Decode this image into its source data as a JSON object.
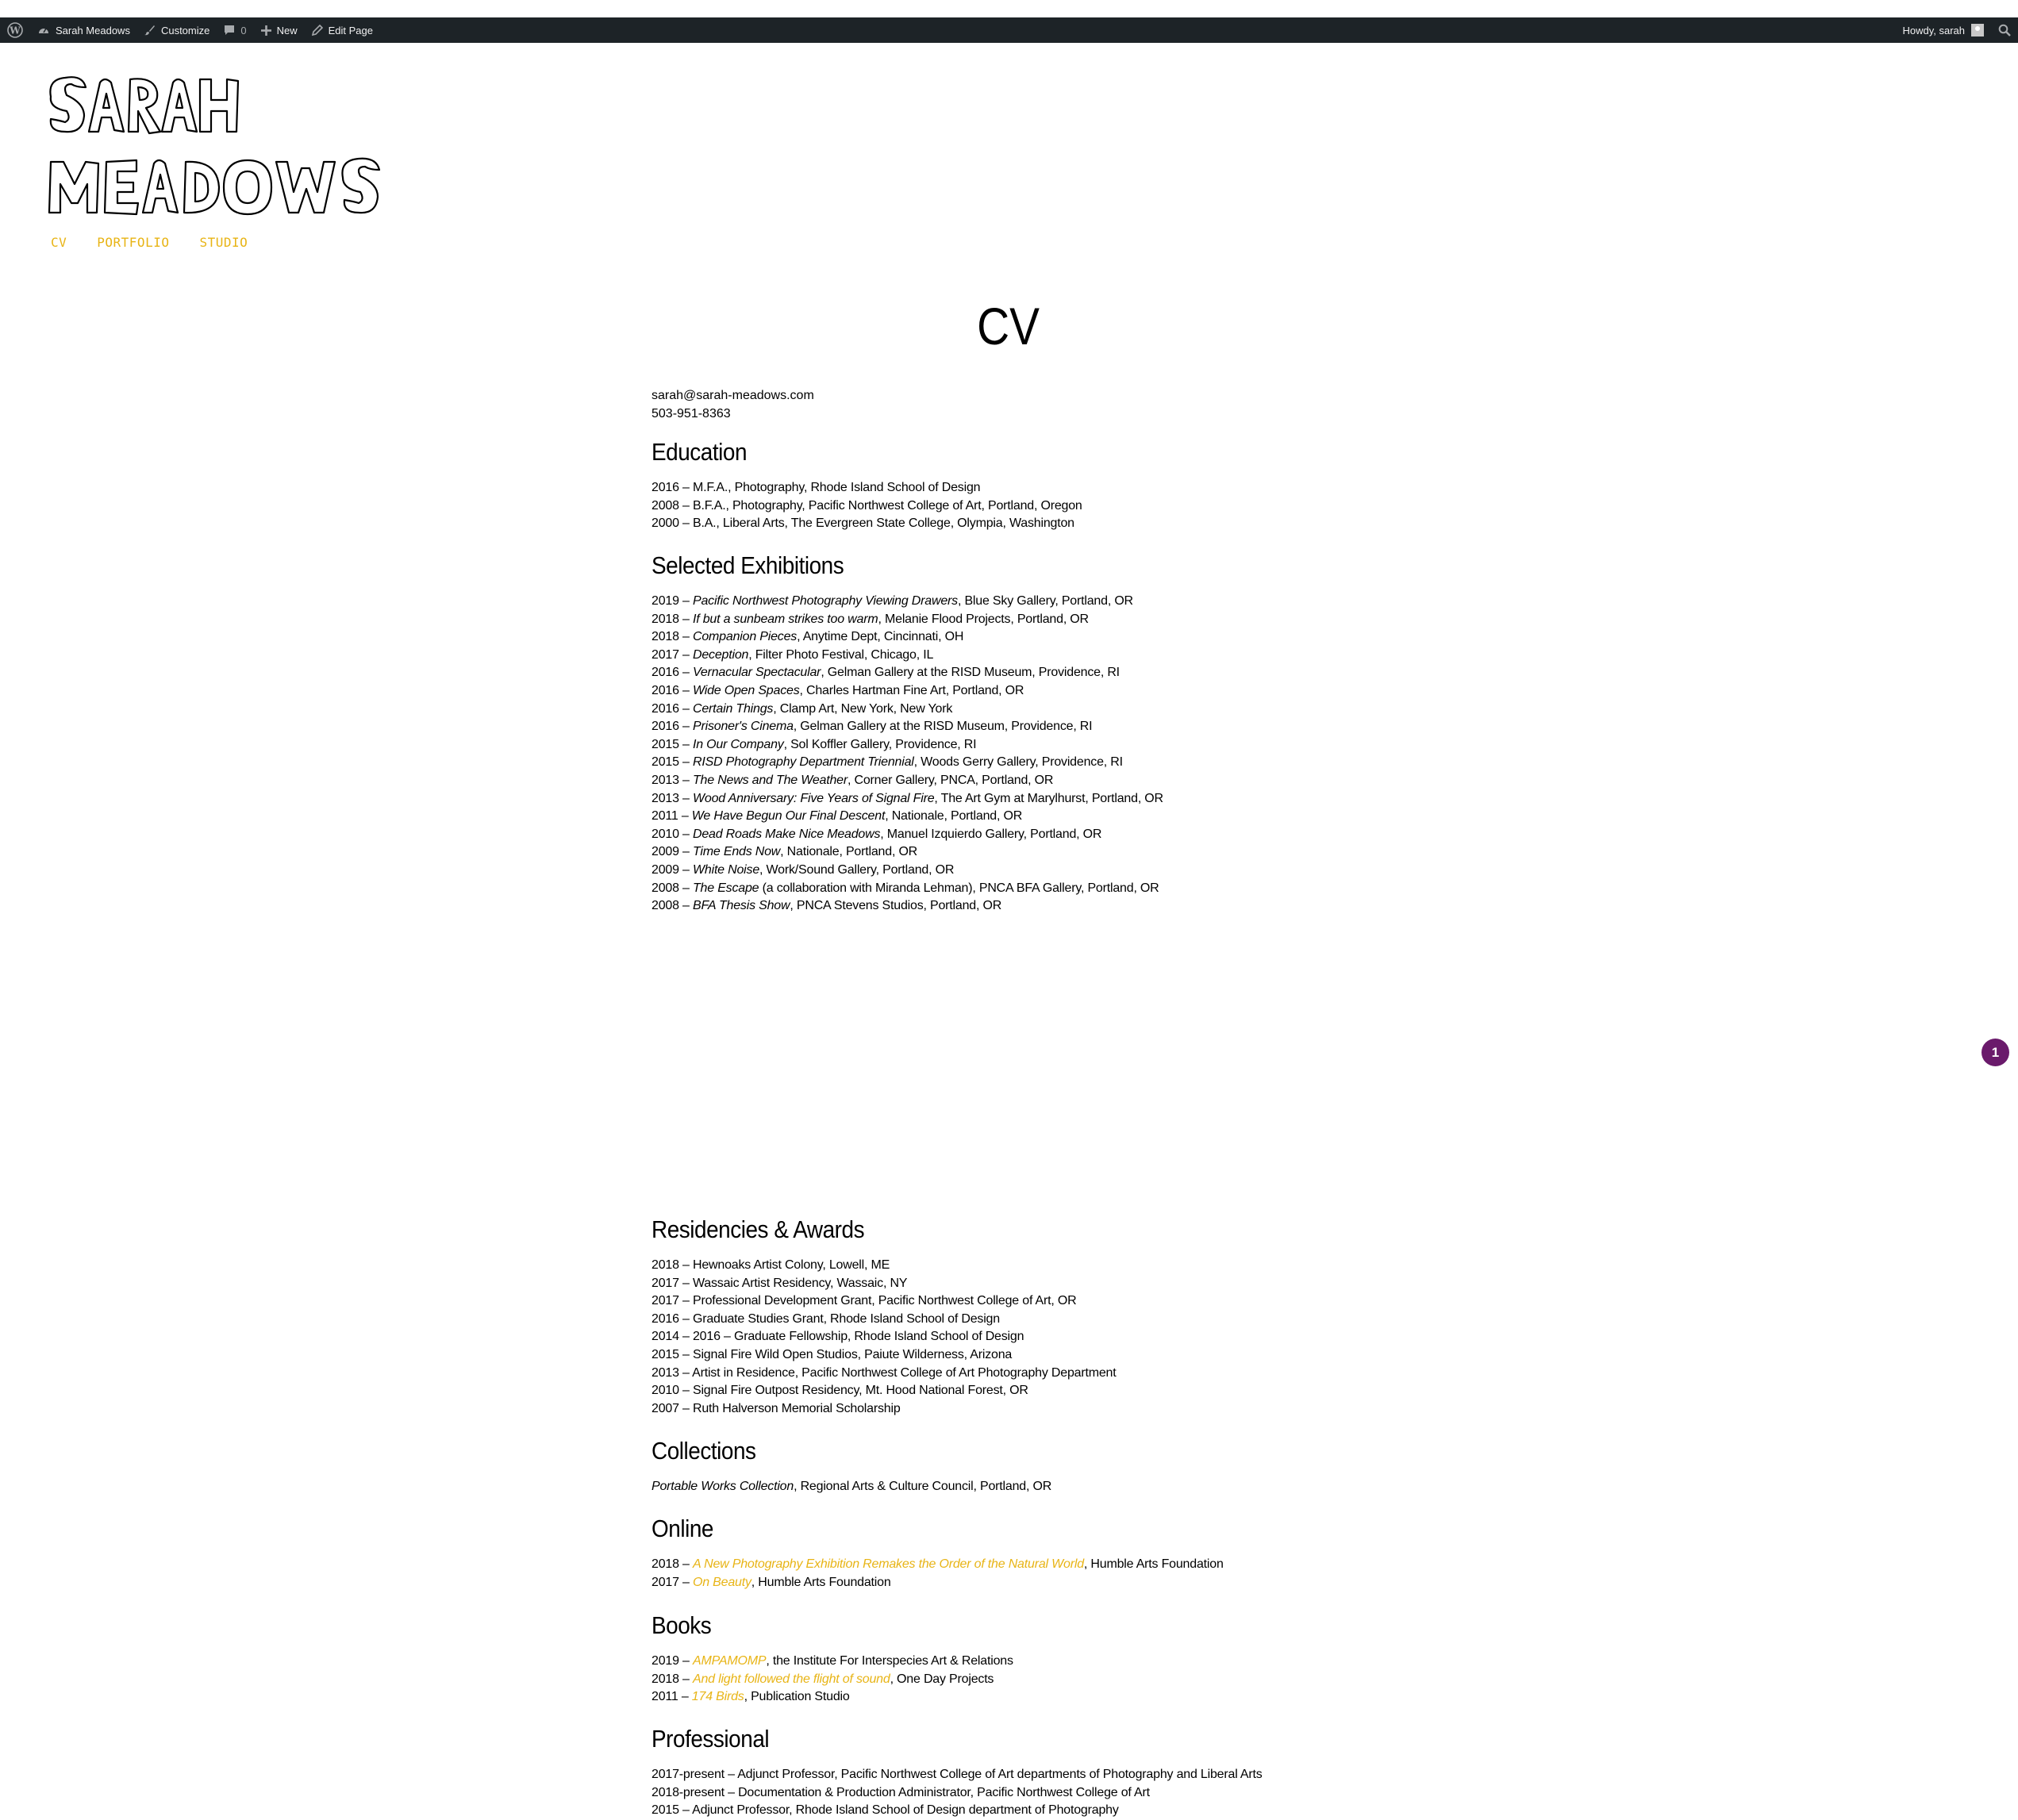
{
  "admin_bar": {
    "site_name": "Sarah Meadows",
    "customize": "Customize",
    "comments_count": "0",
    "new_label": "New",
    "edit_page": "Edit Page",
    "howdy": "Howdy, sarah"
  },
  "site": {
    "logo_text": "SARAH MEADOWS",
    "accent_color": "#e8b415"
  },
  "nav": [
    "CV",
    "PORTFOLIO",
    "STUDIO"
  ],
  "page": {
    "title": "CV",
    "email": "sarah@sarah-meadows.com",
    "phone": "503-951-8363"
  },
  "education": {
    "heading": "Education",
    "items": [
      "2016 – M.F.A., Photography, Rhode Island School of Design",
      "2008 – B.F.A., Photography, Pacific Northwest College of Art, Portland, Oregon",
      "2000 – B.A., Liberal Arts, The Evergreen State College, Olympia, Washington"
    ]
  },
  "exhibitions": {
    "heading": "Selected Exhibitions",
    "items": [
      {
        "year": "2019 – ",
        "title": "Pacific Northwest Photography Viewing Drawers",
        "rest": ", Blue Sky Gallery, Portland, OR"
      },
      {
        "year": "2018 – ",
        "title": "If but a sunbeam strikes too warm",
        "rest": ", Melanie Flood Projects, Portland, OR"
      },
      {
        "year": "2018 – ",
        "title": "Companion Pieces",
        "rest": ", Anytime Dept, Cincinnati, OH"
      },
      {
        "year": "2017 – ",
        "title": "Deception",
        "rest": ", Filter Photo Festival, Chicago, IL"
      },
      {
        "year": "2016 – ",
        "title": "Vernacular Spectacular",
        "rest": ", Gelman Gallery at the RISD Museum, Providence, RI"
      },
      {
        "year": "2016 – ",
        "title": "Wide Open Spaces",
        "rest": ", Charles Hartman Fine Art, Portland, OR"
      },
      {
        "year": "2016 – ",
        "title": "Certain Things",
        "rest": ", Clamp Art, New York, New York"
      },
      {
        "year": "2016 – ",
        "title": "Prisoner's Cinema",
        "rest": ", Gelman Gallery at the RISD Museum, Providence, RI"
      },
      {
        "year": "2015 – ",
        "title": "In Our Company",
        "rest": ", Sol Koffler Gallery, Providence, RI"
      },
      {
        "year": "2015 – ",
        "title": "RISD Photography Department Triennial",
        "rest": ", Woods Gerry Gallery, Providence, RI"
      },
      {
        "year": "2013 – ",
        "title": "The News and The Weather",
        "rest": ", Corner Gallery, PNCA, Portland, OR"
      },
      {
        "year": "2013 – ",
        "title": "Wood Anniversary: Five Years of Signal Fire",
        "rest": ", The Art Gym at Marylhurst, Portland, OR"
      },
      {
        "year": "2011 – ",
        "title": "We Have Begun Our Final Descent",
        "rest": ", Nationale, Portland, OR"
      },
      {
        "year": "2010 – ",
        "title": "Dead Roads Make Nice Meadows",
        "rest": ", Manuel Izquierdo Gallery, Portland, OR"
      },
      {
        "year": "2009 – ",
        "title": "Time Ends Now",
        "rest": ", Nationale, Portland, OR"
      },
      {
        "year": "2009 – ",
        "title": "White Noise",
        "rest": ", Work/Sound Gallery, Portland, OR"
      },
      {
        "year": "2008 – ",
        "title": "The Escape",
        "rest": " (a collaboration with Miranda Lehman), PNCA BFA Gallery, Portland, OR"
      },
      {
        "year": "2008 – ",
        "title": "BFA Thesis Show",
        "rest": ", PNCA Stevens Studios, Portland, OR"
      }
    ]
  },
  "residencies": {
    "heading": "Residencies & Awards",
    "items": [
      "2018 – Hewnoaks Artist Colony, Lowell, ME",
      "2017 – Wassaic Artist Residency, Wassaic, NY",
      "2017 – Professional Development Grant, Pacific Northwest College of Art, OR",
      "2016 – Graduate Studies Grant, Rhode Island School of Design",
      "2014 – 2016 – Graduate Fellowship, Rhode Island School of Design",
      "2015 – Signal Fire Wild Open Studios, Paiute Wilderness, Arizona",
      "2013 – Artist in Residence, Pacific Northwest College of Art Photography Department",
      "2010 – Signal Fire Outpost Residency, Mt. Hood National Forest, OR",
      "2007 – Ruth Halverson Memorial Scholarship"
    ]
  },
  "collections": {
    "heading": "Collections",
    "items": [
      {
        "year": "",
        "title": "Portable Works Collection",
        "rest": ", Regional Arts & Culture Council, Portland, OR"
      }
    ]
  },
  "online": {
    "heading": "Online",
    "items": [
      {
        "year": "2018 – ",
        "link": "A New Photography Exhibition Remakes the Order of the Natural World",
        "rest": ", Humble Arts Foundation"
      },
      {
        "year": "2017 – ",
        "link": "On Beauty",
        "rest": ", Humble Arts Foundation"
      }
    ]
  },
  "books": {
    "heading": "Books",
    "items": [
      {
        "year": "2019 – ",
        "link": "AMPAMOMP",
        "rest": ", the Institute For Interspecies Art & Relations"
      },
      {
        "year": "2018 – ",
        "link": "And light followed the flight of sound",
        "rest": ", One Day Projects"
      },
      {
        "year": "2011 – ",
        "link": "174 Birds",
        "rest": ", Publication Studio"
      }
    ]
  },
  "professional": {
    "heading": "Professional",
    "items": [
      "2017-present –  Adjunct Professor, Pacific Northwest College of Art departments of Photography and Liberal Arts",
      "2018-present – Documentation & Production Administrator, Pacific Northwest College of Art",
      "2015 – Adjunct Professor, Rhode Island School of Design department of Photography"
    ]
  },
  "notification_badge": "1"
}
